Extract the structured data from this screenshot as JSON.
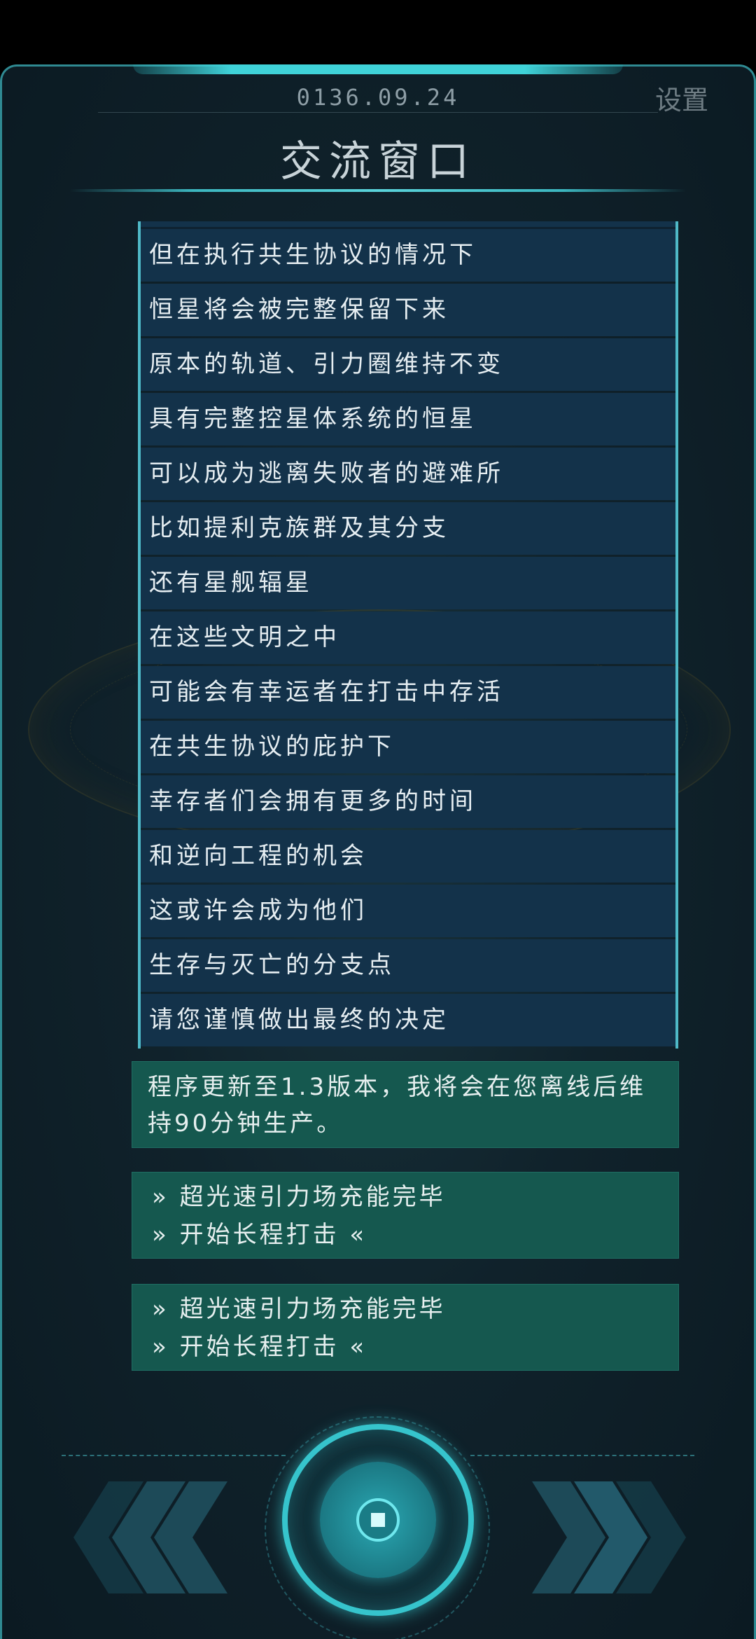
{
  "header": {
    "date": "0136.09.24",
    "settings_label": "设置",
    "title": "交流窗口"
  },
  "messages": [
    "但在执行共生协议的情况下",
    "恒星将会被完整保留下来",
    "原本的轨道、引力圈维持不变",
    "具有完整控星体系统的恒星",
    "可以成为逃离失败者的避难所",
    "比如提利克族群及其分支",
    "还有星舰辐星",
    "在这些文明之中",
    "可能会有幸运者在打击中存活",
    "在共生协议的庇护下",
    "幸存者们会拥有更多的时间",
    "和逆向工程的机会",
    "这或许会成为他们",
    "生存与灭亡的分支点",
    "请您谨慎做出最终的决定"
  ],
  "notice": {
    "text": "程序更新至1.3版本，我将会在您离线后维持90分钟生产。"
  },
  "status_cards": [
    {
      "line1": "» 超光速引力场充能完毕",
      "line2": "» 开始长程打击 «"
    },
    {
      "line1": "» 超光速引力场充能完毕",
      "line2": "» 开始长程打击 «"
    }
  ],
  "controls": {
    "prev_icon": "double-chevron-left-icon",
    "next_icon": "double-chevron-right-icon",
    "center_icon": "stop-square-icon"
  },
  "colors": {
    "accent": "#36c4cc",
    "message_bg": "#13324a",
    "status_bg": "#15584f"
  }
}
